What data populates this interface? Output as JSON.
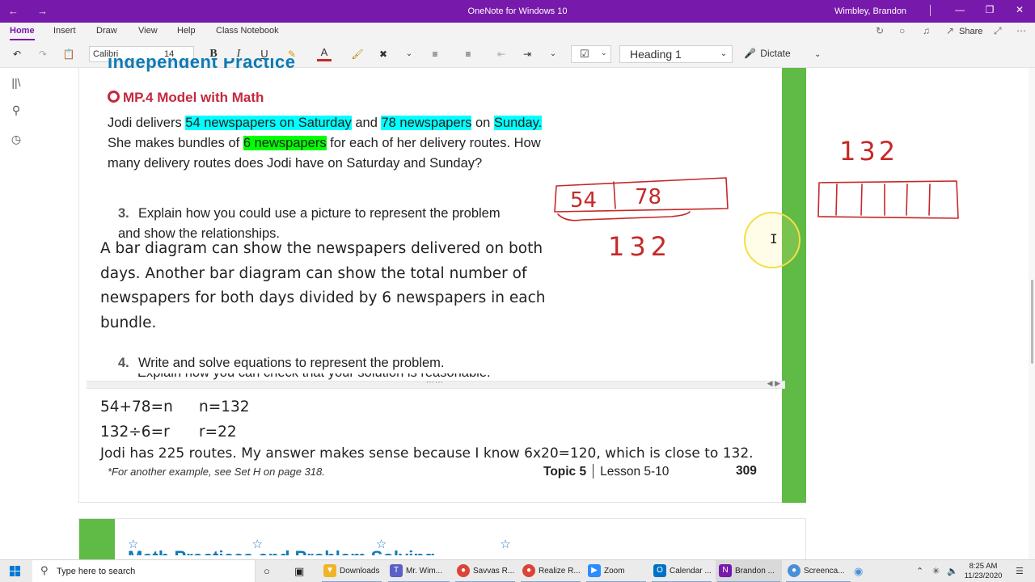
{
  "window": {
    "title": "OneNote for Windows 10",
    "user": "Wimbley, Brandon"
  },
  "ribbon": {
    "tabs": [
      "Home",
      "Insert",
      "Draw",
      "View",
      "Help",
      "Class Notebook"
    ],
    "share_label": "Share",
    "font_name": "Calibri",
    "font_size": "14",
    "paragraph_style": "Heading 1",
    "dictate_label": "Dictate"
  },
  "page": {
    "cut_heading": "Independent Practice",
    "practice_label": "MP.4 Model with Math",
    "problem": {
      "p1": "Jodi delivers ",
      "h1": "54 newspapers on Saturday",
      "p2": " and ",
      "h2": "78 newspapers",
      "p3": " on ",
      "h3": "Sunday.",
      "p4": " She makes bundles of ",
      "h4": "6 newspapers",
      "p5": " for each of her delivery routes. How many delivery routes does Jodi have on Saturday and Sunday?"
    },
    "q3": {
      "number": "3.",
      "text": "Explain how you could use a picture to represent the problem and show the relationships."
    },
    "answer3": "A bar diagram can show the newspapers delivered on both days. Another bar diagram can show the total number of newspapers for both days divided by 6 newspapers in each bundle.",
    "q4": {
      "number": "4.",
      "text": "Write and solve equations to represent the problem.",
      "cut_text": "Explain how you can check that your solution is reasonable."
    },
    "equations": [
      {
        "left": "54+78=n",
        "right": "n=132"
      },
      {
        "left": "132÷6=r",
        "right": "r=22"
      }
    ],
    "answer4": "Jodi has 225 routes. My answer makes sense because I know 6x20=120, which is close to 132.",
    "footnote": "*For another example, see Set H on page 318.",
    "footer": {
      "topic": "Topic 5",
      "lesson": "Lesson 5-10",
      "page_number": "309"
    },
    "next_page_cut_title": "Math Practices and Problem Solving"
  },
  "ink": {
    "bar1_left": "54",
    "bar1_right": "78",
    "total_under": "132",
    "total_top": "132"
  },
  "taskbar": {
    "search_placeholder": "Type here to search",
    "apps": [
      {
        "label": "Downloads",
        "icon": "folder-icon",
        "color": "#f0b429"
      },
      {
        "label": "Mr. Wim...",
        "icon": "teams-icon",
        "color": "#5b5fc7"
      },
      {
        "label": "Savvas R...",
        "icon": "chrome-icon",
        "color": "#db4437"
      },
      {
        "label": "Realize R...",
        "icon": "chrome-icon",
        "color": "#db4437"
      },
      {
        "label": "Zoom",
        "icon": "zoom-icon",
        "color": "#2d8cff"
      },
      {
        "label": "Calendar ...",
        "icon": "outlook-icon",
        "color": "#0072c6"
      },
      {
        "label": "Brandon ...",
        "icon": "onenote-icon",
        "color": "#7719aa"
      },
      {
        "label": "Screenca...",
        "icon": "screencast-icon",
        "color": "#4a90d9"
      }
    ],
    "time": "8:25 AM",
    "date": "11/23/2020"
  },
  "colors": {
    "accent": "#7719aa",
    "highlight_cyan": "#00ffff",
    "highlight_green": "#00ff00",
    "ink_red": "#c62828",
    "page_green": "#5fba46"
  }
}
